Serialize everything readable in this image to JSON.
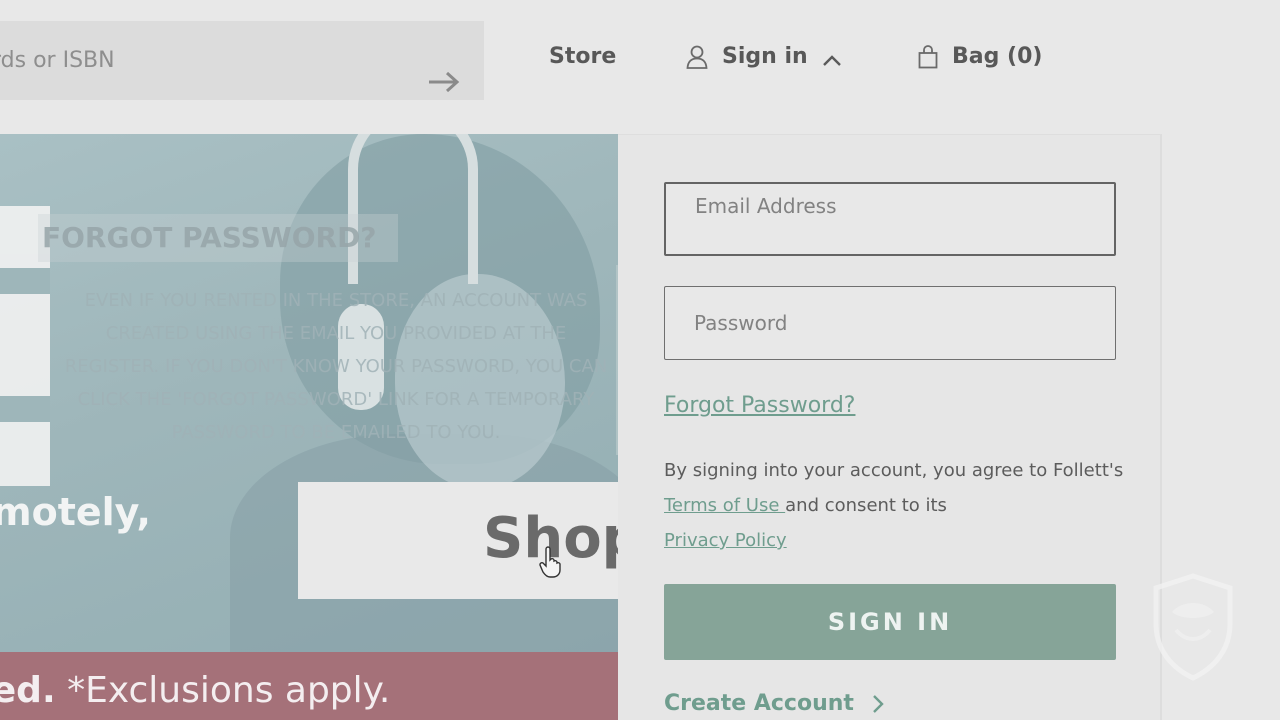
{
  "header": {
    "search_placeholder": "rds or ISBN",
    "store_label": "Store",
    "signin_label": "Sign in",
    "bag_label": "Bag (0)"
  },
  "hero": {
    "forgot_title": "FORGOT PASSWORD?",
    "forgot_lines": [
      "EVEN IF YOU RENTED IN THE STORE, AN ACCOUNT WAS",
      "CREATED USING THE EMAIL YOU PROVIDED AT THE",
      "REGISTER. IF YOU DON'T KNOW YOUR PASSWORD, YOU CAN",
      "CLICK THE 'FORGOT PASSWORD' LINK FOR A TEMPORARY",
      "PASSWORD TO BE EMAILED TO YOU."
    ],
    "tagline": "motely,",
    "shop_label": "Shop",
    "promo_bold": "red.",
    "promo_rest": " *Exclusions apply."
  },
  "signin": {
    "email_placeholder": "Email Address",
    "password_placeholder": "Password",
    "forgot_link": "Forgot Password?",
    "terms_prefix": "By signing into your account, you agree to Follett's ",
    "terms_link": "Terms of Use ",
    "terms_middle": "and consent to its",
    "privacy_link": "Privacy Policy",
    "signin_button": "SIGN IN",
    "create_account": "Create Account"
  },
  "colors": {
    "background": "#e8e8e8",
    "accent_green": "#86a498",
    "link_green": "#6f9d8e",
    "hero_teal": "#9eb6ba",
    "promo_rose": "#a57179"
  },
  "icons": {
    "search_submit": "arrow-right-icon",
    "signin": "user-icon",
    "signin_toggle": "chevron-up-icon",
    "bag": "shopping-bag-icon",
    "create_account": "chevron-right-icon",
    "cursor": "hand-pointer-icon"
  }
}
